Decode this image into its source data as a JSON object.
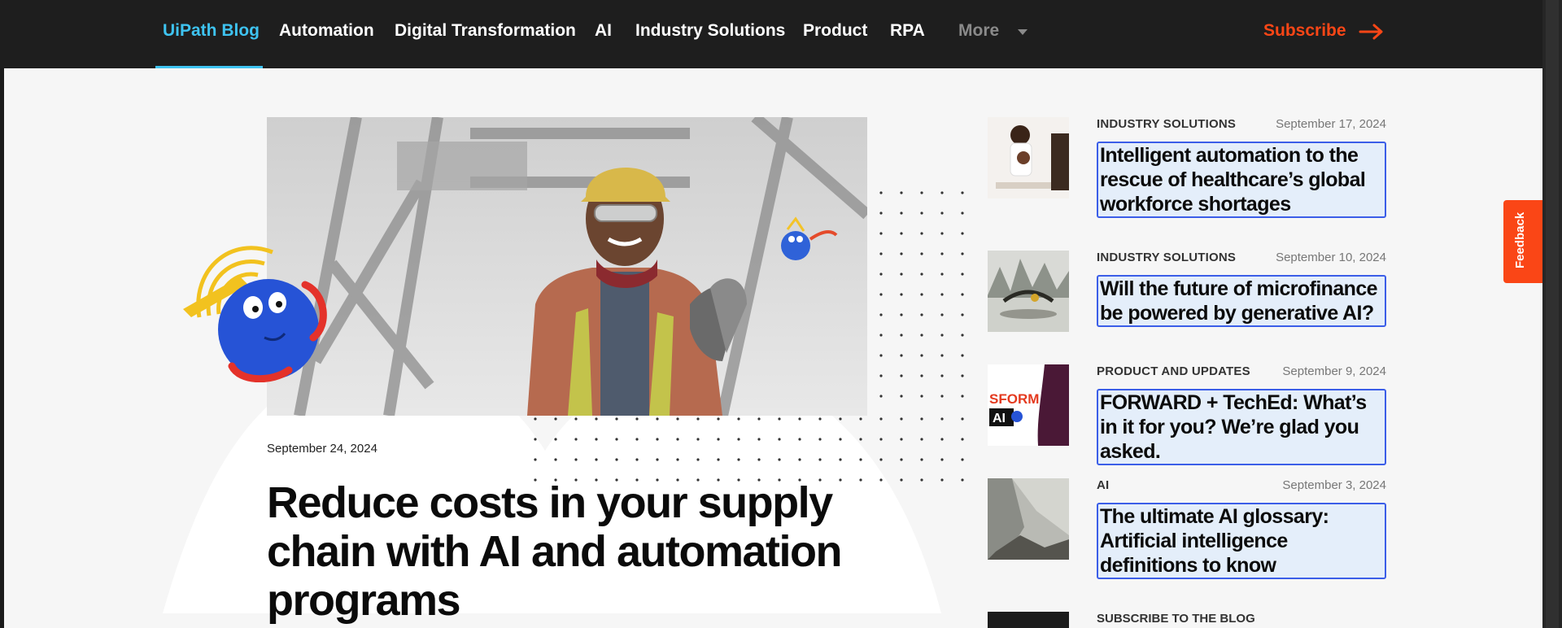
{
  "nav": {
    "items": [
      {
        "label": "UiPath Blog"
      },
      {
        "label": "Automation"
      },
      {
        "label": "Digital Transformation"
      },
      {
        "label": "AI"
      },
      {
        "label": "Industry Solutions"
      },
      {
        "label": "Product"
      },
      {
        "label": "RPA"
      }
    ],
    "more_label": "More",
    "subscribe_label": "Subscribe"
  },
  "hero": {
    "date": "September 24, 2024",
    "title": "Reduce costs in your supply chain with AI and automation programs"
  },
  "sidebar": {
    "posts": [
      {
        "category": "INDUSTRY SOLUTIONS",
        "date": "September 17, 2024",
        "title": "Intelligent automation to the rescue of healthcare’s global workforce shortages"
      },
      {
        "category": "INDUSTRY SOLUTIONS",
        "date": "September 10, 2024",
        "title": "Will the future of microfinance be powered by generative AI?"
      },
      {
        "category": "PRODUCT AND UPDATES",
        "date": "September 9, 2024",
        "title": "FORWARD + TechEd: What’s in it for you? We’re glad you asked."
      },
      {
        "category": "AI",
        "date": "September 3, 2024",
        "title": "The ultimate AI glossary: Artificial intelligence definitions to know"
      }
    ],
    "subscribe_heading": "SUBSCRIBE TO THE BLOG",
    "thumb3_text": {
      "line1": "SFORM",
      "line2": "AI"
    }
  },
  "feedback_label": "Feedback",
  "colors": {
    "accent_blue": "#3ec3f0",
    "brand_orange": "#fa4616",
    "nav_bg": "#1e1e1e",
    "page_bg": "#f6f6f6",
    "title_border": "#3b5ee8",
    "title_highlight": "#e4eefa"
  },
  "icons": {
    "subscribe": "arrow-right-icon",
    "more": "chevron-down-icon"
  }
}
